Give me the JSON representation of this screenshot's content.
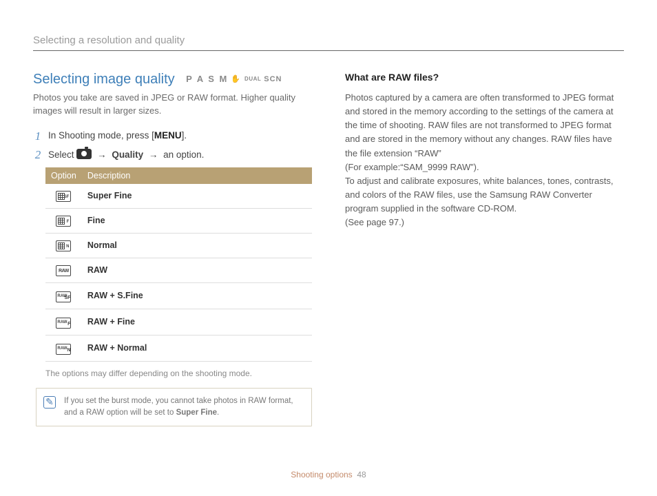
{
  "page_header": "Selecting a resolution and quality",
  "left": {
    "title": "Selecting image quality",
    "modes": {
      "pasm": "P A S M",
      "dual": "DUAL",
      "scn": "SCN"
    },
    "intro": "Photos you take are saved in JPEG or RAW format. Higher quality images will result in larger sizes.",
    "step1_pre": "In Shooting mode, press [",
    "step1_key": "MENU",
    "step1_post": "].",
    "step2_pre": "Select ",
    "step2_quality": "Quality",
    "step2_post": " an option.",
    "table": {
      "h_option": "Option",
      "h_desc": "Description",
      "rows": [
        {
          "desc": "Super Fine",
          "icon": "sf"
        },
        {
          "desc": "Fine",
          "icon": "f"
        },
        {
          "desc": "Normal",
          "icon": "n"
        },
        {
          "desc": "RAW",
          "icon": "raw"
        },
        {
          "desc": "RAW + S.Fine",
          "icon": "raw-sf"
        },
        {
          "desc": "RAW + Fine",
          "icon": "raw-f"
        },
        {
          "desc": "RAW + Normal",
          "icon": "raw-n"
        }
      ]
    },
    "footnote": "The options may differ depending on the shooting mode.",
    "note_pre": "If you set the burst mode, you cannot take photos in RAW format, and a RAW option will be set to ",
    "note_bold": "Super Fine",
    "note_post": "."
  },
  "right": {
    "heading": "What are RAW files?",
    "body": "Photos captured by a camera are often transformed to JPEG format and stored in the memory according to the settings of the camera at the time of shooting. RAW files are not transformed to JPEG format and are stored in the memory without any changes. RAW files have the file extension “RAW”\n(For example:“SAM_9999 RAW”).\nTo adjust and calibrate exposures, white balances, tones, contrasts, and colors of the RAW files, use the Samsung RAW Converter program supplied in the software CD-ROM.\n(See page 97.)"
  },
  "footer": {
    "section": "Shooting options",
    "page": "48"
  }
}
